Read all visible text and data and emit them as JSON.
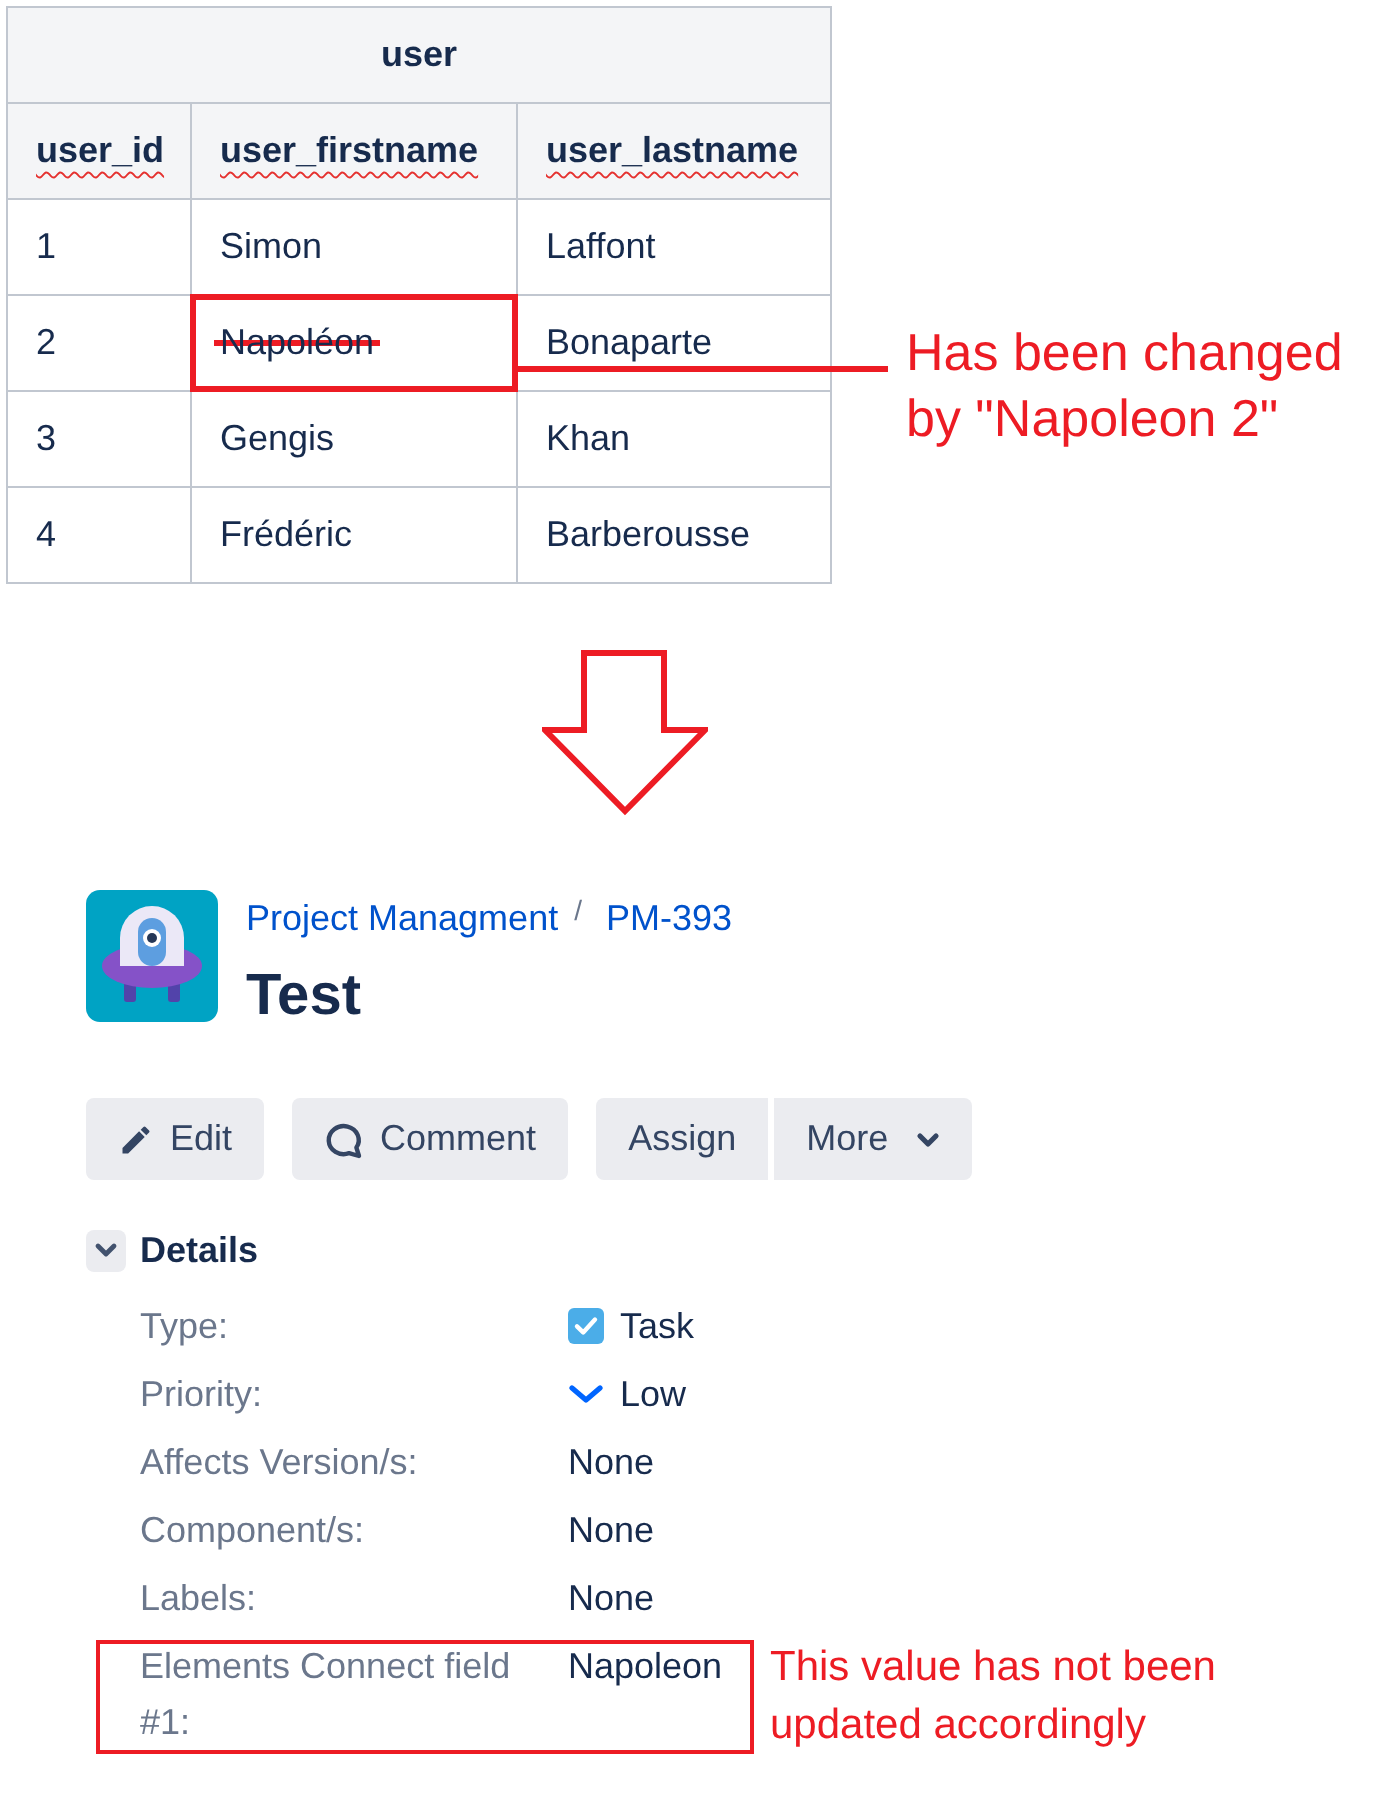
{
  "table": {
    "title": "user",
    "columns": [
      {
        "label": "user_id",
        "spell_flagged": true
      },
      {
        "label": "user_firstname",
        "spell_flagged": true
      },
      {
        "label": "user_lastname",
        "spell_flagged": true
      }
    ],
    "rows": [
      [
        {
          "text": "1",
          "struck": false,
          "highlighted": false
        },
        {
          "text": "Simon",
          "struck": false,
          "highlighted": false
        },
        {
          "text": "Laffont",
          "struck": false,
          "highlighted": false
        }
      ],
      [
        {
          "text": "2",
          "struck": false,
          "highlighted": false
        },
        {
          "text": "Napoléon",
          "struck": true,
          "highlighted": true
        },
        {
          "text": "Bonaparte",
          "struck": false,
          "highlighted": false
        }
      ],
      [
        {
          "text": "3",
          "struck": false,
          "highlighted": false
        },
        {
          "text": "Gengis",
          "struck": false,
          "highlighted": false
        },
        {
          "text": "Khan",
          "struck": false,
          "highlighted": false
        }
      ],
      [
        {
          "text": "4",
          "struck": false,
          "highlighted": false
        },
        {
          "text": "Frédéric",
          "struck": false,
          "highlighted": false
        },
        {
          "text": "Barberousse",
          "struck": false,
          "highlighted": false
        }
      ]
    ],
    "callout": "Has been changed by \"Napoleon 2\""
  },
  "issue": {
    "project": "Project Managment",
    "separator": "/",
    "key": "PM-393",
    "title": "Test"
  },
  "toolbar": {
    "groups": [
      {
        "buttons": [
          {
            "label": "Edit",
            "kind": "edit"
          }
        ]
      },
      {
        "buttons": [
          {
            "label": "Comment",
            "kind": "comment"
          }
        ]
      },
      {
        "buttons": [
          {
            "label": "Assign",
            "kind": "plain"
          },
          {
            "label": "More",
            "kind": "dropdown"
          }
        ]
      }
    ]
  },
  "details": {
    "title": "Details",
    "expanded": true,
    "fields": [
      {
        "label": "Type:",
        "value": "Task",
        "kind": "issue_type",
        "highlighted": false
      },
      {
        "label": "Priority:",
        "value": "Low",
        "kind": "priority",
        "highlighted": false
      },
      {
        "label": "Affects Version/s:",
        "value": "None",
        "kind": "text",
        "highlighted": false
      },
      {
        "label": "Component/s:",
        "value": "None",
        "kind": "text",
        "highlighted": false
      },
      {
        "label": "Labels:",
        "value": "None",
        "kind": "text",
        "highlighted": false
      },
      {
        "label": "Elements Connect field #1:",
        "value": "Napoleon",
        "kind": "text",
        "highlighted": true,
        "callout": "This value has not been updated accordingly"
      }
    ]
  }
}
